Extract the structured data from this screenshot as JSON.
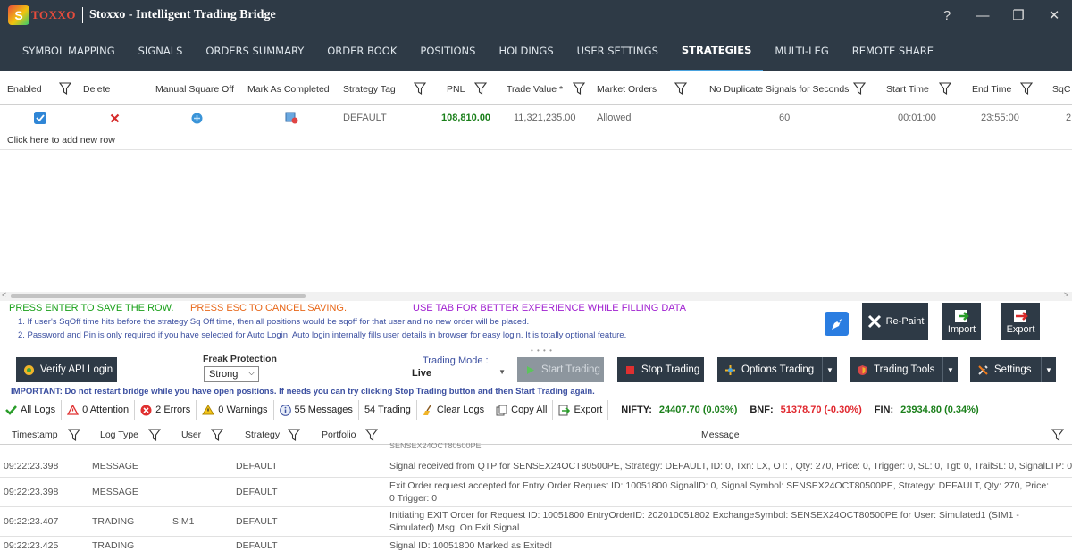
{
  "app": {
    "logo_text": "TOXXO",
    "title": "Stoxxo - Intelligent Trading Bridge",
    "window_controls": [
      "?",
      "—",
      "❐",
      "✕"
    ]
  },
  "nav": {
    "tabs": [
      "SYMBOL MAPPING",
      "SIGNALS",
      "ORDERS SUMMARY",
      "ORDER BOOK",
      "POSITIONS",
      "HOLDINGS",
      "USER SETTINGS",
      "STRATEGIES",
      "MULTI-LEG",
      "REMOTE SHARE"
    ],
    "active": "STRATEGIES"
  },
  "grid": {
    "columns": [
      "Enabled",
      "Delete",
      "Manual Square Off",
      "Mark As Completed",
      "Strategy Tag",
      "PNL",
      "Trade Value *",
      "Market Orders",
      "No Duplicate Signals for Seconds",
      "Start Time",
      "End Time",
      "SqC"
    ],
    "row": {
      "enabled": true,
      "strategy_tag": "DEFAULT",
      "pnl": "108,810.00",
      "trade_value": "11,321,235.00",
      "market_orders": "Allowed",
      "no_dup_seconds": "60",
      "start_time": "00:01:00",
      "end_time": "23:55:00",
      "sqc": "2"
    },
    "add_row": "Click here to add new row"
  },
  "hints": {
    "enter": "PRESS ENTER TO SAVE THE ROW.",
    "esc": "PRESS ESC TO CANCEL SAVING.",
    "tab": "USE TAB FOR BETTER EXPERIENCE WHILE FILLING DATA",
    "note1": "1. If user's SqOff time hits before the strategy Sq Off time, then all positions would be sqoff for that user and no new order will be placed.",
    "note2": "2. Password and Pin is only required if you have selected for Auto Login. Auto login internally fills user details in browser for easy login. It is totally optional feature."
  },
  "tools": {
    "repaint": "Re-Paint",
    "import": "Import",
    "export": "Export"
  },
  "controls": {
    "verify": "Verify API Login",
    "freak_label": "Freak Protection",
    "freak_value": "Strong",
    "mode_label": "Trading Mode :",
    "mode_value": "Live",
    "start": "Start Trading",
    "stop": "Stop Trading",
    "options": "Options Trading",
    "tools": "Trading Tools",
    "settings": "Settings",
    "important": "IMPORTANT: Do not restart bridge while you have open positions. If needs you can try clicking Stop Trading button and then Start Trading again."
  },
  "logbar": {
    "all": "All Logs",
    "attention": "0 Attention",
    "errors": "2 Errors",
    "warnings": "0 Warnings",
    "messages": "55 Messages",
    "trading": "54 Trading",
    "clear": "Clear Logs",
    "copy": "Copy All",
    "export": "Export",
    "nifty_label": "NIFTY:",
    "nifty": "24407.70 (0.03%)",
    "bnf_label": "BNF:",
    "bnf": "51378.70 (-0.30%)",
    "fin_label": "FIN:",
    "fin": "23934.80 (0.34%)"
  },
  "log": {
    "columns": [
      "Timestamp",
      "Log Type",
      "User",
      "Strategy",
      "Portfolio",
      "Message"
    ],
    "cut_text": "SENSEX24OCT80500PE",
    "rows": [
      {
        "ts": "09:22:23.398",
        "type": "MESSAGE",
        "user": "",
        "strategy": "DEFAULT",
        "msg": "Signal received from QTP for SENSEX24OCT80500PE, Strategy: DEFAULT, ID: 0, Txn: LX, OT: , Qty: 270, Price: 0, Trigger: 0, SL: 0, Tgt: 0, TrailSL: 0, SignalLTP: 0"
      },
      {
        "ts": "09:22:23.398",
        "type": "MESSAGE",
        "user": "",
        "strategy": "DEFAULT",
        "msg": "Exit Order request accepted for Entry Order Request ID: 10051800  SignalID: 0, Signal Symbol: SENSEX24OCT80500PE, Strategy: DEFAULT, Qty: 270, Price: 0 Trigger: 0"
      },
      {
        "ts": "09:22:23.407",
        "type": "TRADING",
        "user": "SIM1",
        "strategy": "DEFAULT",
        "msg": "Initiating EXIT Order for Request ID: 10051800  EntryOrderID: 202010051802  ExchangeSymbol: SENSEX24OCT80500PE  for User: Simulated1 (SIM1 - Simulated)  Msg: On Exit Signal"
      },
      {
        "ts": "09:22:23.425",
        "type": "TRADING",
        "user": "",
        "strategy": "DEFAULT",
        "msg": "Signal ID: 10051800 Marked as Exited!"
      }
    ]
  },
  "colors": {
    "dark": "#2e3a46",
    "accent": "#4aa3df",
    "green": "#1a7f1a",
    "red": "#e0262d",
    "blue": "#3b4fa0",
    "purple": "#a020d0"
  }
}
